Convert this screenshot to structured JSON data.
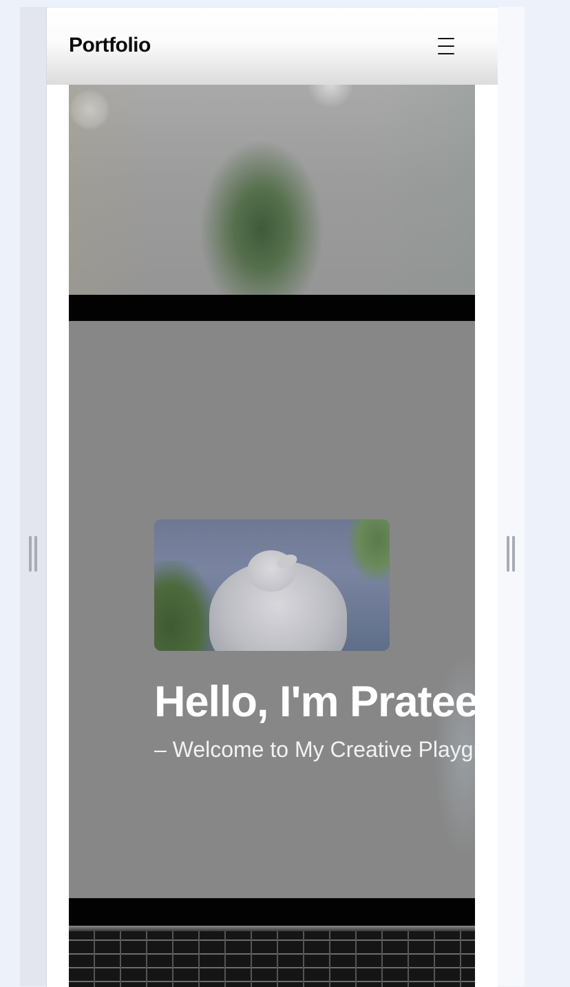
{
  "header": {
    "logo": "Portfolio",
    "menu_icon": "hamburger-menu-icon"
  },
  "hero": {
    "video_thumbnail": "bunny-video-thumbnail",
    "title": "Hello, I'm Prateek",
    "subtitle": "– Welcome to My Creative Playground"
  },
  "panels": {
    "left_handle_icon": "drag-handle-icon",
    "right_handle_icon": "drag-handle-icon"
  }
}
